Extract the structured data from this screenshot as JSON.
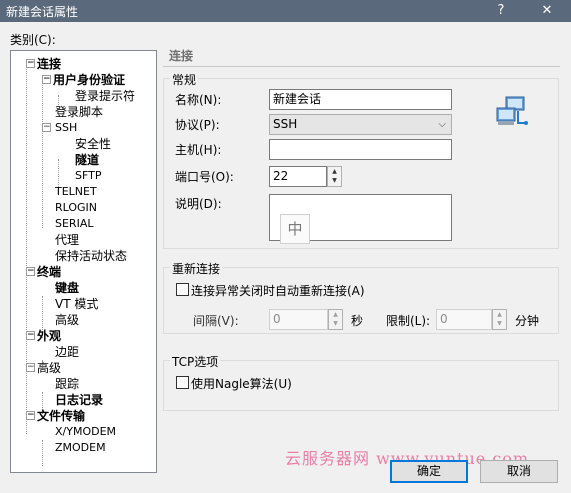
{
  "window": {
    "title": "新建会话属性",
    "help_glyph": "?",
    "close_glyph": "✕"
  },
  "category_label": "类别(C):",
  "tree": {
    "items": [
      {
        "label": "连接",
        "expander": "−"
      },
      {
        "label": "用户身份验证",
        "expander": "−"
      },
      {
        "label": "登录提示符"
      },
      {
        "label": "登录脚本"
      },
      {
        "label": "SSH",
        "expander": "−"
      },
      {
        "label": "安全性"
      },
      {
        "label": "隧道"
      },
      {
        "label": "SFTP"
      },
      {
        "label": "TELNET"
      },
      {
        "label": "RLOGIN"
      },
      {
        "label": "SERIAL"
      },
      {
        "label": "代理"
      },
      {
        "label": "保持活动状态"
      },
      {
        "label": "终端",
        "expander": "−"
      },
      {
        "label": "键盘"
      },
      {
        "label": "VT 模式"
      },
      {
        "label": "高级"
      },
      {
        "label": "外观",
        "expander": "−"
      },
      {
        "label": "边距"
      },
      {
        "label": "高级",
        "expander": "−"
      },
      {
        "label": "跟踪"
      },
      {
        "label": "日志记录"
      },
      {
        "label": "文件传输",
        "expander": "−"
      },
      {
        "label": "X/YMODEM"
      },
      {
        "label": "ZMODEM"
      }
    ]
  },
  "panel": {
    "header": "连接",
    "general": {
      "title": "常规",
      "name_label": "名称(N):",
      "name_value": "新建会话",
      "protocol_label": "协议(P):",
      "protocol_value": "SSH",
      "host_label": "主机(H):",
      "host_value": "",
      "port_label": "端口号(O):",
      "port_value": "22",
      "description_label": "说明(D):",
      "ime_indicator": "中"
    },
    "reconnect": {
      "title": "重新连接",
      "auto_reconnect_label": "连接异常关闭时自动重新连接(A)",
      "auto_reconnect_checked": false,
      "interval_label": "间隔(V):",
      "interval_value": "0",
      "seconds_unit": "秒",
      "limit_label": "限制(L):",
      "limit_value": "0",
      "minutes_unit": "分钟"
    },
    "tcp": {
      "title": "TCP选项",
      "nagle_label": "使用Nagle算法(U)",
      "nagle_checked": false
    }
  },
  "buttons": {
    "ok": "确定",
    "cancel": "取消"
  },
  "watermark": "云服务器网 www.yuntue.com"
}
